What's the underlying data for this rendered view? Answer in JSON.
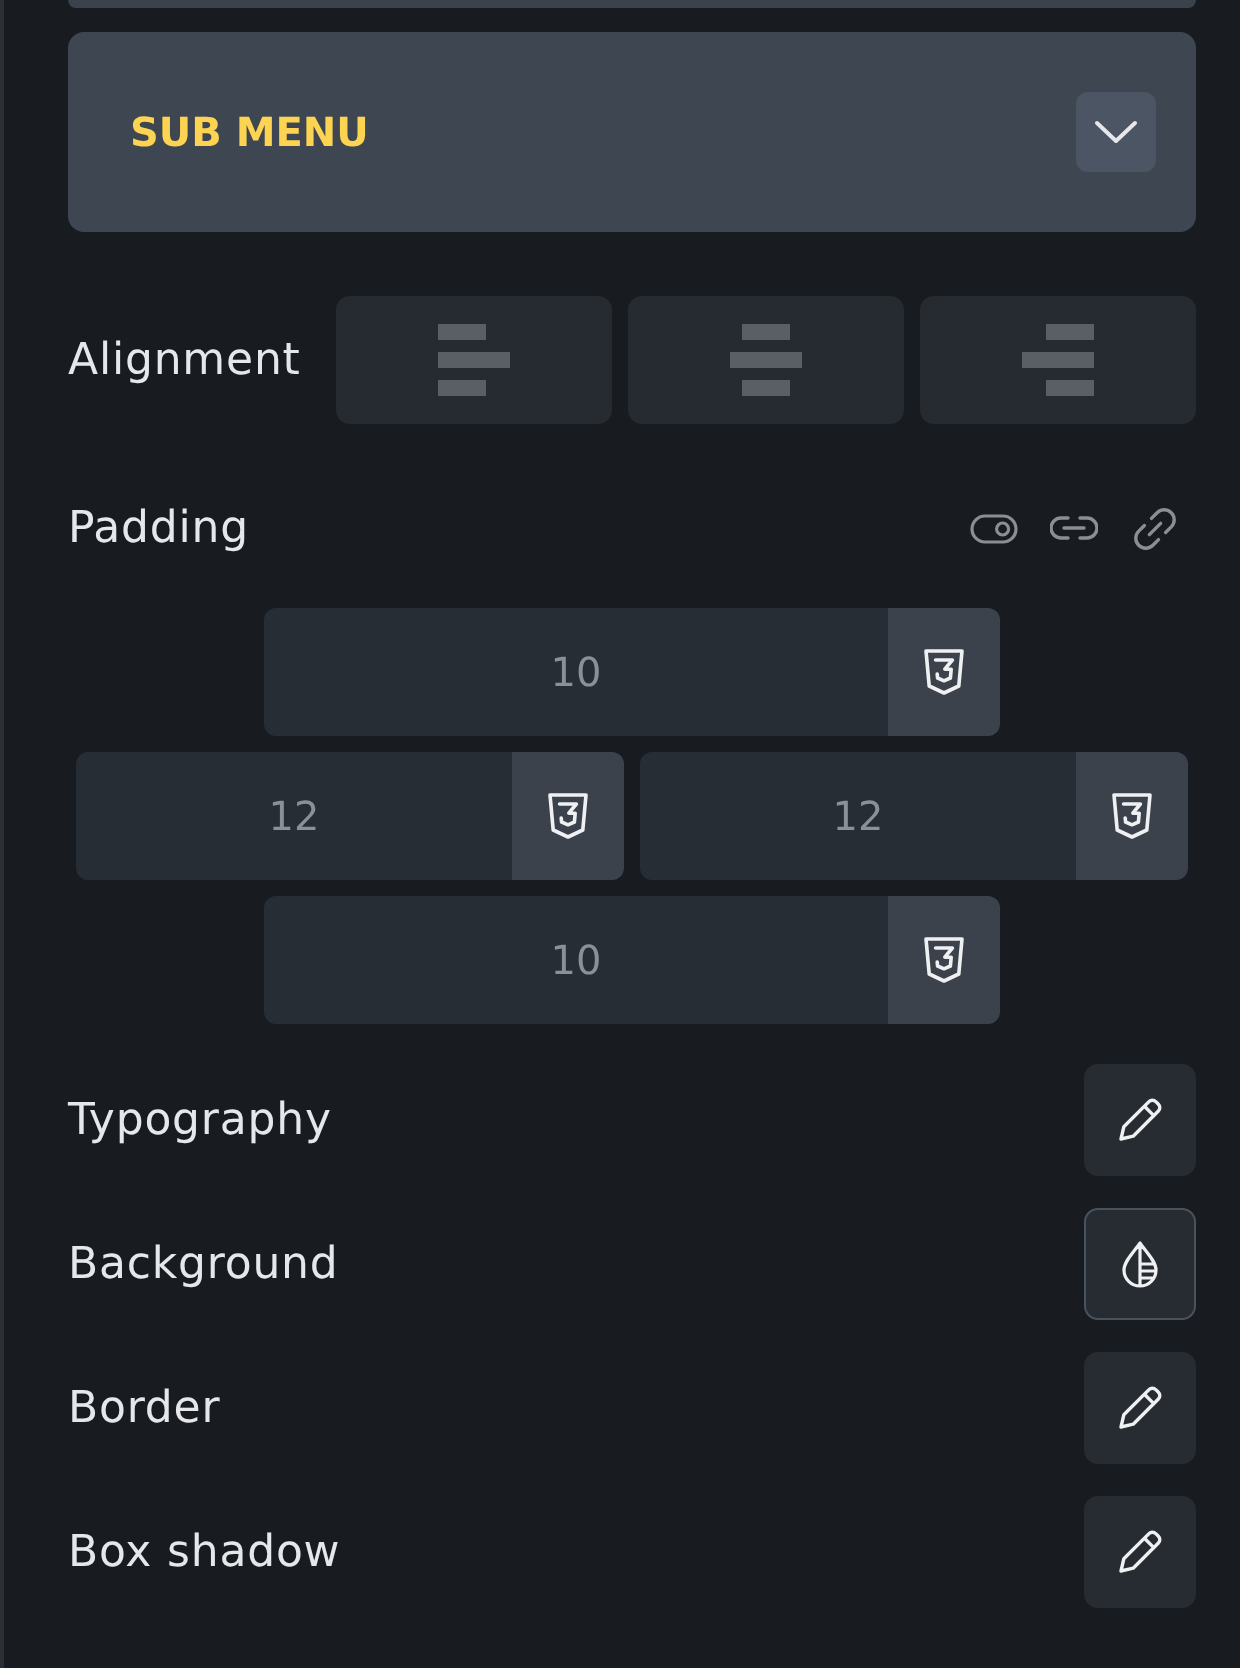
{
  "sub_menu": {
    "title": "SUB MENU",
    "expanded": false
  },
  "alignment": {
    "label": "Alignment",
    "options": [
      {
        "kind": "left",
        "selected": false
      },
      {
        "kind": "center",
        "selected": false
      },
      {
        "kind": "right",
        "selected": false
      }
    ]
  },
  "padding": {
    "label": "Padding",
    "fields": [
      {
        "value": "10"
      },
      {
        "value": "12"
      },
      {
        "value": "12"
      },
      {
        "value": "10"
      }
    ]
  },
  "style_rows": [
    {
      "label": "Typography",
      "kind": "edit",
      "focused": false
    },
    {
      "label": "Background",
      "kind": "color",
      "focused": true
    },
    {
      "label": "Border",
      "kind": "edit",
      "focused": false
    },
    {
      "label": "Box shadow",
      "kind": "edit",
      "focused": false
    }
  ]
}
